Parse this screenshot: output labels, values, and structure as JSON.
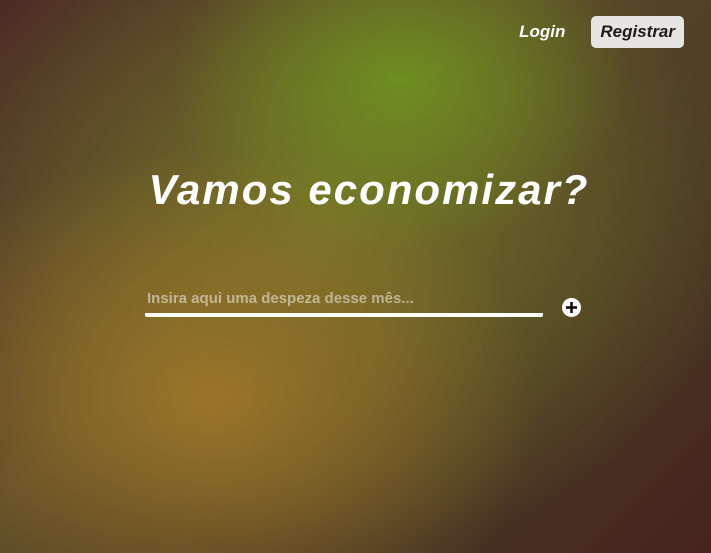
{
  "nav": {
    "login_label": "Login",
    "register_label": "Registrar"
  },
  "hero": {
    "title": "Vamos economizar?"
  },
  "expense_form": {
    "input_placeholder": "Insira aqui uma despeza desse mês...",
    "input_value": "",
    "add_icon": "plus-circle-icon"
  },
  "colors": {
    "text": "#ffffff",
    "register_button_bg": "#e7e5e3",
    "register_button_text": "#1b1b1b"
  }
}
